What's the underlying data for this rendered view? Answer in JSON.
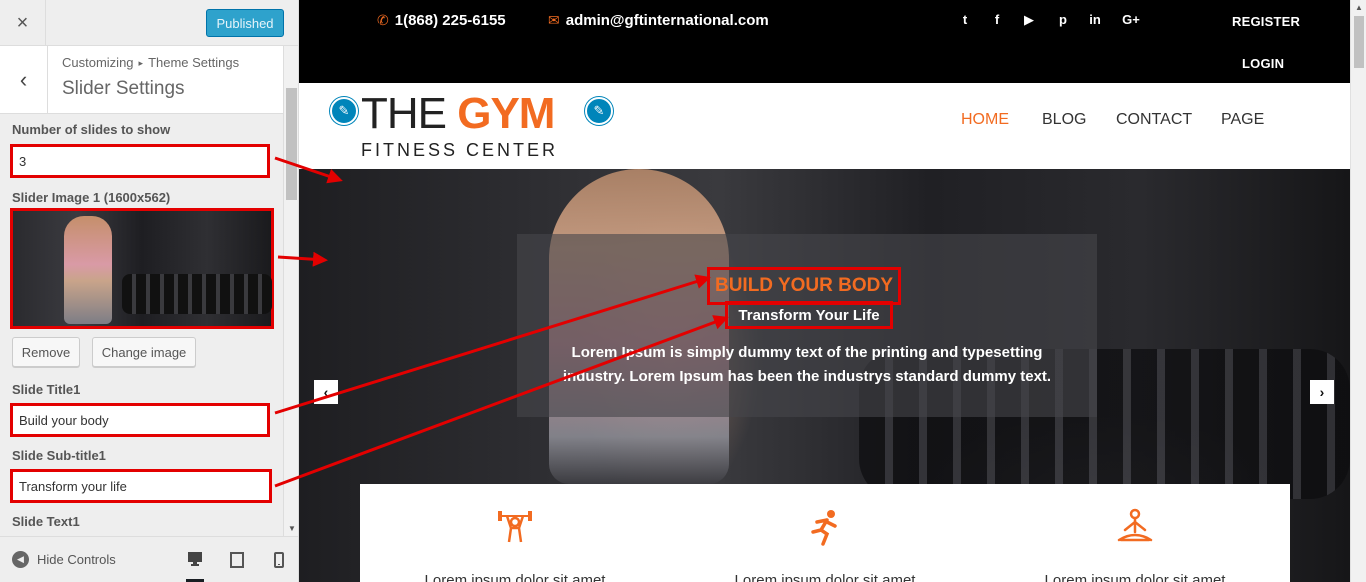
{
  "customizer": {
    "close_icon": "×",
    "publish_label": "Published",
    "breadcrumb": {
      "root": "Customizing",
      "separator": "▸",
      "current": "Theme Settings"
    },
    "section_title": "Slider Settings",
    "back_icon": "‹",
    "controls": {
      "slides_label": "Number of slides to show",
      "slides_value": "3",
      "image_label": "Slider Image 1 (1600x562)",
      "remove_label": "Remove",
      "change_label": "Change image",
      "title_label": "Slide Title1",
      "title_value": "Build your body",
      "subtitle_label": "Slide Sub-title1",
      "subtitle_value": "Transform your life",
      "text_label": "Slide Text1"
    },
    "footer": {
      "hide_controls": "Hide Controls",
      "hide_icon": "◀"
    }
  },
  "site": {
    "topbar": {
      "phone": "1(868) 225-6155",
      "email": "admin@gftinternational.com",
      "register": "REGISTER",
      "login": "LOGIN",
      "social": [
        "twitter-icon",
        "facebook-icon",
        "youtube-icon",
        "pinterest-icon",
        "linkedin-icon",
        "google-plus-icon"
      ]
    },
    "logo": {
      "the": "THE ",
      "gym": "GYM",
      "sub": "FITNESS CENTER"
    },
    "nav": [
      "HOME",
      "BLOG",
      "CONTACT",
      "PAGE"
    ],
    "nav_active": "HOME",
    "slider": {
      "title": "BUILD YOUR BODY",
      "subtitle": "Transform Your Life",
      "text": "Lorem Ipsum is simply dummy text of the printing and typesetting industry. Lorem Ipsum has been the industrys standard dummy text.",
      "prev_icon": "‹",
      "next_icon": "›"
    },
    "features": [
      {
        "icon": "weightlifting-icon",
        "text": "Lorem ipsum dolor sit amet"
      },
      {
        "icon": "running-icon",
        "text": "Lorem ipsum dolor sit amet"
      },
      {
        "icon": "meditation-icon",
        "text": "Lorem ipsum dolor sit amet"
      }
    ]
  },
  "colors": {
    "accent": "#f26b21",
    "wp_blue": "#0085ba",
    "annotation_red": "#e30000",
    "topbar": "#000000"
  }
}
